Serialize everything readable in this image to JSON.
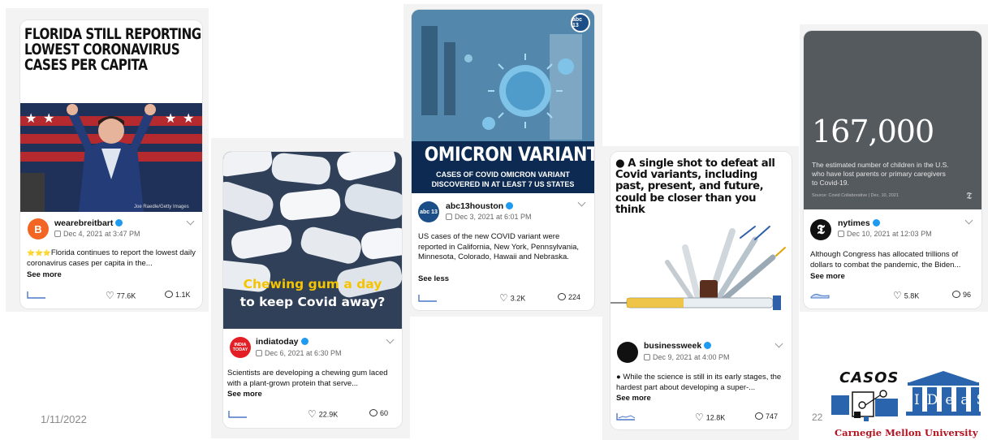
{
  "slide": {
    "date": "1/11/2022",
    "page_number": "22"
  },
  "posts": [
    {
      "headline_lines": [
        "FLORIDA STILL REPORTING",
        "LOWEST CORONAVIRUS",
        "CASES PER CAPITA"
      ],
      "photo_credit": "Joe Raedle/Getty Images",
      "handle": "wearebreitbart",
      "avatar": "B",
      "date": "Dec 4, 2021 at 3:47 PM",
      "caption_prefix": "⭐⭐⭐",
      "caption": "Florida continues to report the lowest daily coronavirus cases per capita in the...",
      "see_more": "See more",
      "likes": "77.6K",
      "comments": "1.1K"
    },
    {
      "headline_line1": "Chewing gum a day",
      "headline_line2": "to keep Covid away?",
      "handle": "indiatoday",
      "avatar": "INDIA TODAY",
      "date": "Dec 6, 2021 at 6:30 PM",
      "caption": "Scientists are developing a chewing gum laced with a plant-grown protein that serve...",
      "see_more": "See more",
      "likes": "22.9K",
      "comments": "60"
    },
    {
      "headline": "OMICRON VARIANT",
      "subhead_line1": "CASES OF COVID OMICRON VARIANT",
      "subhead_line2": "DISCOVERED IN AT LEAST 7 US STATES",
      "badge": "abc 13",
      "handle": "abc13houston",
      "date": "Dec 3, 2021 at 6:01 PM",
      "caption": "US cases of the new COVID variant were reported in California, New York, Pennsylvania, Minnesota, Colorado, Hawaii and Nebraska.",
      "see_less": "See less",
      "likes": "3.2K",
      "comments": "224"
    },
    {
      "headline": "● A single shot to defeat all Covid variants, including past, present, and future, could be closer than you think",
      "handle": "businessweek",
      "date": "Dec 9, 2021 at 4:00 PM",
      "caption": "● While the science is still in its early stages, the hardest part about developing a super-...",
      "see_more": "See more",
      "likes": "12.8K",
      "comments": "747"
    },
    {
      "big_number": "167,000",
      "stat_text": "The estimated number of children in the U.S. who have lost parents or primary caregivers to Covid-19.",
      "source": "Source: Covid Collaborative | Dec. 10, 2021",
      "logo": "𝕿",
      "handle": "nytimes",
      "date": "Dec 10, 2021 at 12:03 PM",
      "caption": "Although Congress has allocated trillions of dollars to combat the pandemic, the Biden...",
      "see_more": "See more",
      "likes": "5.8K",
      "comments": "96"
    }
  ],
  "logos": {
    "casos": "CASOS",
    "ideas": "IDeaS",
    "cmu": "Carnegie Mellon University"
  },
  "colors": {
    "breitbart": "#f26522",
    "indiatoday": "#e31e24",
    "nyt_bg": "#555a5f",
    "omicron_band": "#0d2b52",
    "cmu_red": "#b3121f",
    "ideas_blue": "#2a64ad"
  }
}
